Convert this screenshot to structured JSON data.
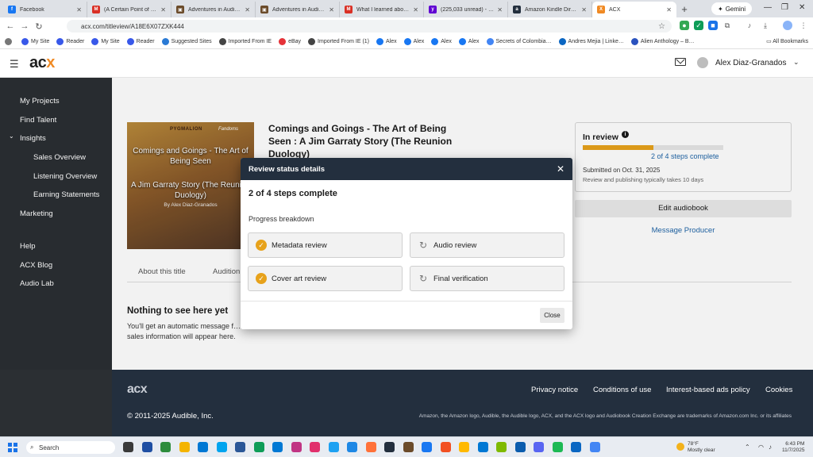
{
  "browser": {
    "tabs": [
      {
        "label": "Facebook",
        "color": "#1877f2",
        "glyph": "f"
      },
      {
        "label": "(A Certain Point of View…",
        "color": "#d93025",
        "glyph": "M"
      },
      {
        "label": "Adventures in Audiobo…",
        "color": "#6b4b2a",
        "glyph": "▣"
      },
      {
        "label": "Adventures in Audiobo…",
        "color": "#6b4b2a",
        "glyph": "▣"
      },
      {
        "label": "What I learned about …",
        "color": "#d93025",
        "glyph": "M"
      },
      {
        "label": "(225,033 unread) - alexd…",
        "color": "#6001d2",
        "glyph": "y"
      },
      {
        "label": "Amazon Kindle Direct P…",
        "color": "#232f3e",
        "glyph": "a"
      },
      {
        "label": "ACX",
        "color": "#f08a24",
        "glyph": "X"
      }
    ],
    "gemini": "Gemini",
    "url": "acx.com/titleview/A18E6X07ZXK444",
    "bookmarks": [
      {
        "label": "",
        "color": "#777"
      },
      {
        "label": "My Site",
        "color": "#3858e9"
      },
      {
        "label": "Reader",
        "color": "#3858e9"
      },
      {
        "label": "My Site",
        "color": "#3858e9"
      },
      {
        "label": "Reader",
        "color": "#3858e9"
      },
      {
        "label": "Suggested Sites",
        "color": "#2a7ad5"
      },
      {
        "label": "Imported From IE",
        "color": "#444"
      },
      {
        "label": "eBay",
        "color": "#e53238"
      },
      {
        "label": "Imported From IE (1)",
        "color": "#444"
      },
      {
        "label": "Alex",
        "color": "#1877f2"
      },
      {
        "label": "Alex",
        "color": "#1877f2"
      },
      {
        "label": "Alex",
        "color": "#1877f2"
      },
      {
        "label": "Alex",
        "color": "#1877f2"
      },
      {
        "label": "Secrets of Colombia…",
        "color": "#4285f4"
      },
      {
        "label": "Andres Mejia | Linke…",
        "color": "#0a66c2"
      },
      {
        "label": "Alien Anthology – B…",
        "color": "#2a52be"
      }
    ],
    "all_bookmarks": "All Bookmarks"
  },
  "header": {
    "logo_main": "ac",
    "logo_accent": "x",
    "username": "Alex Diaz-Granados"
  },
  "sidebar": {
    "items": [
      {
        "label": "My Projects",
        "sub": false
      },
      {
        "label": "Find Talent",
        "sub": false
      },
      {
        "label": "Insights",
        "sub": false,
        "expanded": true
      },
      {
        "label": "Sales Overview",
        "sub": true
      },
      {
        "label": "Listening Overview",
        "sub": true
      },
      {
        "label": "Earning Statements",
        "sub": true
      },
      {
        "label": "Marketing",
        "sub": false
      },
      {
        "label": "Help",
        "sub": false
      },
      {
        "label": "ACX Blog",
        "sub": false
      },
      {
        "label": "Audio Lab",
        "sub": false
      }
    ]
  },
  "book": {
    "cover_tag1": "PYGMALION",
    "cover_tag2": "Fandoms",
    "cover_title": "Comings and Goings - The Art of Being Seen",
    "cover_subtitle": "A Jim Garraty Story (The Reunion Duology)",
    "cover_author": "By Alex Diaz-Granados",
    "title": "Comings and Goings - The Art of Being Seen : A Jim Garraty Story (The Reunion Duology)"
  },
  "status_card": {
    "title": "In review",
    "progress_fraction": 0.5,
    "steps_text": "2 of 4 steps complete",
    "submitted": "Submitted on Oct. 31, 2025",
    "note": "Review and publishing typically takes 10 days",
    "edit_label": "Edit audiobook",
    "message_label": "Message Producer"
  },
  "page_tabs": [
    "About this title",
    "Audition"
  ],
  "empty_state": {
    "title": "Nothing to see here yet",
    "desc": "You'll get an automatic message f… sales information will appear here."
  },
  "modal": {
    "title": "Review status details",
    "steps_text": "2 of 4 steps complete",
    "breakdown_label": "Progress breakdown",
    "steps": [
      {
        "label": "Metadata review",
        "done": true
      },
      {
        "label": "Audio review",
        "done": false
      },
      {
        "label": "Cover art review",
        "done": true
      },
      {
        "label": "Final verification",
        "done": false
      }
    ],
    "close_label": "Close"
  },
  "footer": {
    "logo": "acx",
    "links": [
      "Privacy notice",
      "Conditions of use",
      "Interest-based ads policy",
      "Cookies"
    ],
    "copyright": "© 2011-2025 Audible, Inc.",
    "trademark": "Amazon, the Amazon logo, Audible, the Audible logo, ACX, and the ACX logo and Audiobook Creation Exchange are trademarks of Amazon.com Inc. or its affiliates"
  },
  "taskbar": {
    "search_placeholder": "Search",
    "weather_temp": "78°F",
    "weather_desc": "Mostly clear",
    "time": "6:43 PM",
    "date": "11/7/2025",
    "apps": [
      "#3a3a3a",
      "#1f4fa3",
      "#2d8c3c",
      "#f4b400",
      "#0078d4",
      "#00a4ef",
      "#2b5797",
      "#0f9d58",
      "#0078d4",
      "#c13584",
      "#e1306c",
      "#1da1f2",
      "#1e88e5",
      "#ff7139",
      "#232f3e",
      "#6b4b2a",
      "#1877f2",
      "#f25022",
      "#ffb900",
      "#0078d4",
      "#7fba00",
      "#0b5cad",
      "#5865f2",
      "#1db954",
      "#0a66c2",
      "#4285f4"
    ]
  }
}
